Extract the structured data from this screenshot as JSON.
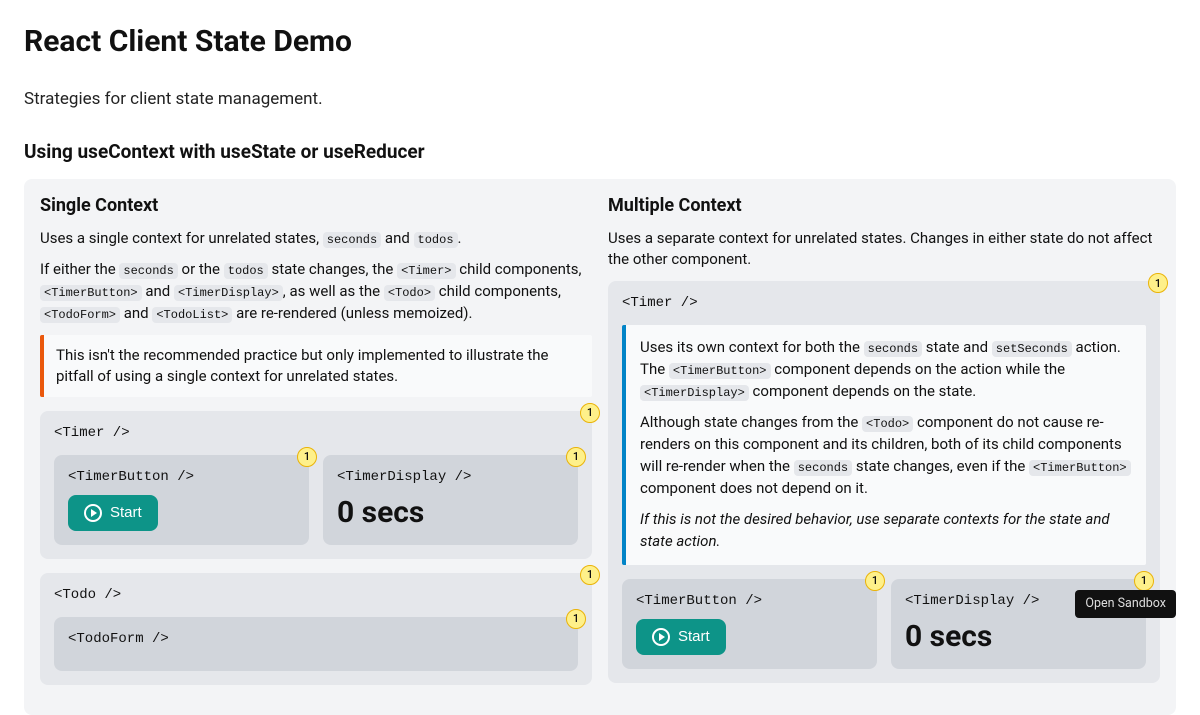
{
  "title": "React Client State Demo",
  "subtitle": "Strategies for client state management.",
  "section_heading": "Using useContext with useState or useReducer",
  "badge": "1",
  "left": {
    "heading": "Single Context",
    "p1a": "Uses a single context for unrelated states, ",
    "p1_code1": "seconds",
    "p1b": " and ",
    "p1_code2": "todos",
    "p1c": ".",
    "p2a": "If either the ",
    "p2_code1": "seconds",
    "p2b": " or the ",
    "p2_code2": "todos",
    "p2c": " state changes, the ",
    "p2_code3": "<Timer>",
    "p2d": " child components, ",
    "p2_code4": "<TimerButton>",
    "p2e": " and ",
    "p2_code5": "<TimerDisplay>",
    "p2f": ", as well as the ",
    "p2_code6": "<Todo>",
    "p2g": " child components, ",
    "p2_code7": "<TodoForm>",
    "p2h": " and ",
    "p2_code8": "<TodoList>",
    "p2i": " are re-rendered (unless memoized).",
    "note": "This isn't the recommended practice but only implemented to illustrate the pitfall of using a single context for unrelated states.",
    "timer_card": "<Timer />",
    "timer_button_card": "<TimerButton />",
    "timer_display_card": "<TimerDisplay />",
    "start_label": "Start",
    "secs": "0 secs",
    "todo_card": "<Todo />",
    "todoform_card": "<TodoForm />"
  },
  "right": {
    "heading": "Multiple Context",
    "p1": "Uses a separate context for unrelated states. Changes in either state do not affect the other component.",
    "timer_card": "<Timer />",
    "note_p1a": "Uses its own context for both the ",
    "note_code1": "seconds",
    "note_p1b": " state and ",
    "note_code2": "setSeconds",
    "note_p1c": " action. The ",
    "note_code3": "<TimerButton>",
    "note_p1d": " component depends on the action while the ",
    "note_code4": "<TimerDisplay>",
    "note_p1e": " component depends on the state.",
    "note_p2a": "Although state changes from the ",
    "note_code5": "<Todo>",
    "note_p2b": " component do not cause re-renders on this component and its children, both of its child components will re-render when the ",
    "note_code6": "seconds",
    "note_p2c": " state changes, even if the ",
    "note_code7": "<TimerButton>",
    "note_p2d": " component does not depend on it.",
    "note_p3": "If this is not the desired behavior, use separate contexts for the state and state action.",
    "timer_button_card": "<TimerButton />",
    "timer_display_card": "<TimerDisplay />",
    "start_label": "Start",
    "secs": "0 secs"
  },
  "sandbox": "Open Sandbox"
}
